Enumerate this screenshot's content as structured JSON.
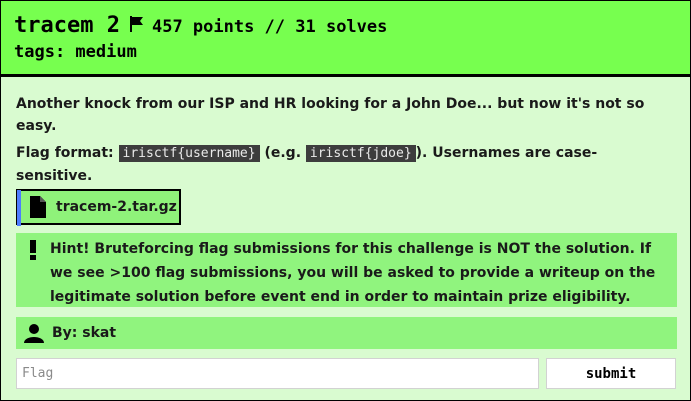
{
  "challenge": {
    "title": "tracem 2",
    "points_text": "457 points // 31 solves",
    "tags_text": "tags: medium",
    "description": "Another knock from our ISP and HR looking for a John Doe... but now it's not so easy.",
    "flag_format": {
      "prefix": "Flag format: ",
      "format_code": "irisctf{username}",
      "middle": " (e.g. ",
      "example_code": "irisctf{jdoe}",
      "suffix": "). Usernames are case-sensitive."
    },
    "attachment": {
      "filename": "tracem-2.tar.gz",
      "icon": "document-icon"
    },
    "hint": "Hint! Bruteforcing flag submissions for this challenge is NOT the solution. If we see >100 flag submissions, you will be asked to provide a writeup on the legitimate solution before event end in order to maintain prize eligibility.",
    "author": "By: skat",
    "flag_input": {
      "placeholder": "Flag",
      "value": ""
    },
    "submit_label": "submit"
  },
  "colors": {
    "header_bg": "#77ff4f",
    "page_bg": "#d9fbd0",
    "panel_bg": "#90f47e",
    "file_accent": "#4d7cff",
    "code_bg": "#3d3d3d"
  }
}
